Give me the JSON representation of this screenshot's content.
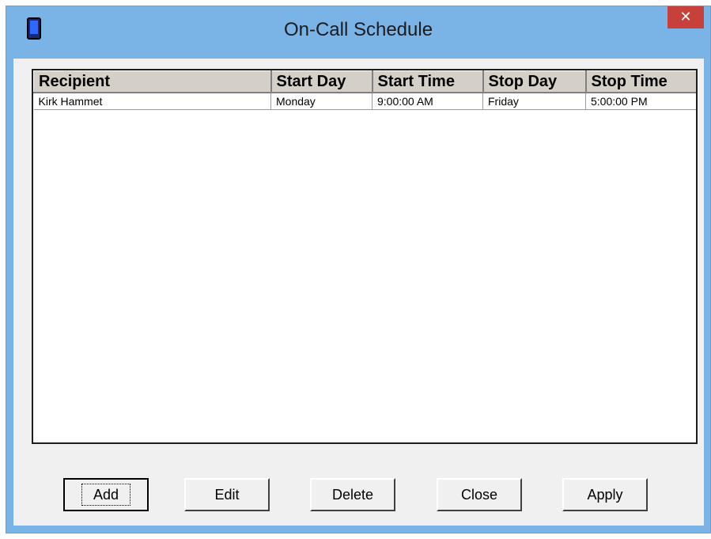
{
  "window": {
    "title": "On-Call Schedule",
    "close_glyph": "✕",
    "icon": "mobile-phone-icon"
  },
  "table": {
    "columns": [
      "Recipient",
      "Start Day",
      "Start Time",
      "Stop Day",
      "Stop Time"
    ],
    "rows": [
      [
        "Kirk Hammet",
        "Monday",
        "9:00:00 AM",
        "Friday",
        "5:00:00 PM"
      ]
    ]
  },
  "buttons": {
    "add": "Add",
    "edit": "Edit",
    "delete": "Delete",
    "close": "Close",
    "apply": "Apply"
  }
}
